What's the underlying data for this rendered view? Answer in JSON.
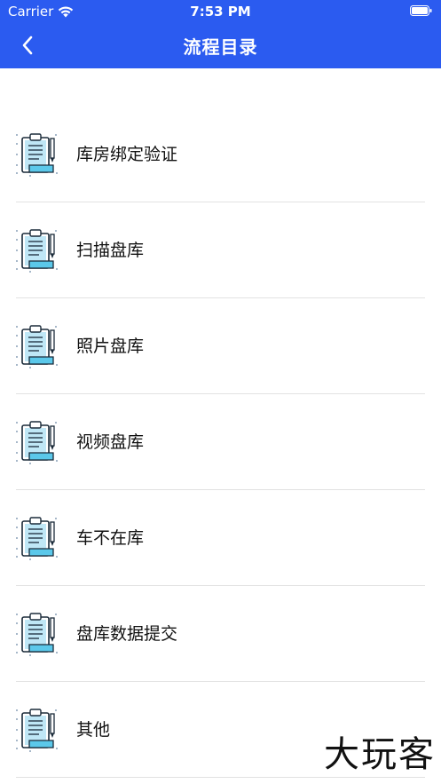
{
  "status_bar": {
    "carrier": "Carrier",
    "time": "7:53 PM"
  },
  "nav": {
    "title": "流程目录",
    "back_icon": "chevron-left-icon"
  },
  "colors": {
    "header_bg": "#2B5BF0",
    "icon_accent": "#5BC8EA"
  },
  "items": [
    {
      "label": "库房绑定验证",
      "icon": "clipboard-icon"
    },
    {
      "label": "扫描盘库",
      "icon": "clipboard-icon"
    },
    {
      "label": "照片盘库",
      "icon": "clipboard-icon"
    },
    {
      "label": "视频盘库",
      "icon": "clipboard-icon"
    },
    {
      "label": "车不在库",
      "icon": "clipboard-icon"
    },
    {
      "label": "盘库数据提交",
      "icon": "clipboard-icon"
    },
    {
      "label": "其他",
      "icon": "clipboard-icon"
    }
  ],
  "watermark": "大玩客"
}
